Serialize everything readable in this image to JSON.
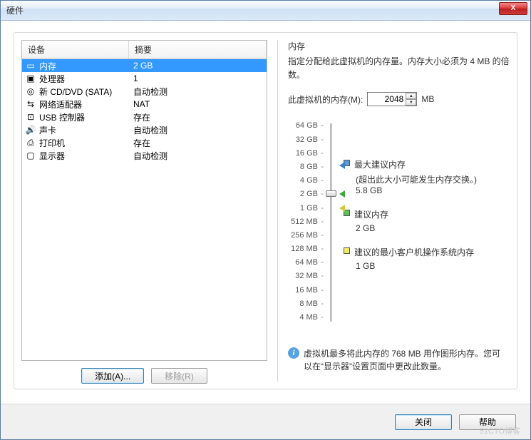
{
  "window": {
    "title": "硬件",
    "close_x": "X"
  },
  "table": {
    "header_device": "设备",
    "header_summary": "摘要",
    "rows": [
      {
        "icon": "memory-icon",
        "glyph": "▭",
        "name": "内存",
        "summary": "2 GB",
        "selected": true
      },
      {
        "icon": "cpu-icon",
        "glyph": "▣",
        "name": "处理器",
        "summary": "1"
      },
      {
        "icon": "cd-icon",
        "glyph": "◎",
        "name": "新 CD/DVD (SATA)",
        "summary": "自动检测"
      },
      {
        "icon": "network-icon",
        "glyph": "⇆",
        "name": "网络适配器",
        "summary": "NAT"
      },
      {
        "icon": "usb-icon",
        "glyph": "⊡",
        "name": "USB 控制器",
        "summary": "存在"
      },
      {
        "icon": "sound-icon",
        "glyph": "🔊",
        "name": "声卡",
        "summary": "自动检测"
      },
      {
        "icon": "printer-icon",
        "glyph": "⎙",
        "name": "打印机",
        "summary": "存在"
      },
      {
        "icon": "display-icon",
        "glyph": "▢",
        "name": "显示器",
        "summary": "自动检测"
      }
    ]
  },
  "buttons": {
    "add": "添加(A)...",
    "remove": "移除(R)",
    "close": "关闭",
    "help": "帮助"
  },
  "right": {
    "title": "内存",
    "desc": "指定分配给此虚拟机的内存量。内存大小必须为 4 MB 的倍数。",
    "mem_label": "此虚拟机的内存(M):",
    "mem_value": "2048",
    "mem_unit": "MB",
    "scale": [
      "64 GB",
      "32 GB",
      "16 GB",
      "8 GB",
      "4 GB",
      "2 GB",
      "1 GB",
      "512 MB",
      "256 MB",
      "128 MB",
      "64 MB",
      "32 MB",
      "16 MB",
      "8 MB",
      "4 MB"
    ],
    "legend_max_title": "最大建议内存",
    "legend_max_note": "(超出此大小可能发生内存交换。)",
    "legend_max_value": "5.8 GB",
    "legend_rec_title": "建议内存",
    "legend_rec_value": "2 GB",
    "legend_min_title": "建议的最小客户机操作系统内存",
    "legend_min_value": "1 GB",
    "info": "虚拟机最多将此内存的 768 MB 用作图形内存。您可以在“显示器”设置页面中更改此数量。"
  },
  "watermark": "51CTO博客"
}
